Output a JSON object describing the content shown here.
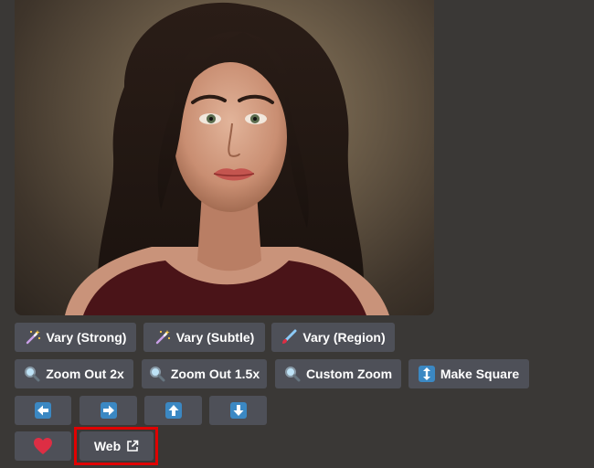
{
  "image": {
    "subject": "portrait-image"
  },
  "row1": [
    {
      "label": "Vary (Strong)",
      "icon": "magic-wand-icon"
    },
    {
      "label": "Vary (Subtle)",
      "icon": "magic-wand-icon"
    },
    {
      "label": "Vary (Region)",
      "icon": "paintbrush-icon"
    }
  ],
  "row2": [
    {
      "label": "Zoom Out 2x",
      "icon": "magnifier-icon"
    },
    {
      "label": "Zoom Out 1.5x",
      "icon": "magnifier-icon"
    },
    {
      "label": "Custom Zoom",
      "icon": "magnifier-icon"
    },
    {
      "label": "Make Square",
      "icon": "up-down-arrow-icon"
    }
  ],
  "row3": [
    {
      "icon": "arrow-left-icon"
    },
    {
      "icon": "arrow-right-icon"
    },
    {
      "icon": "arrow-up-icon"
    },
    {
      "icon": "arrow-down-icon"
    }
  ],
  "row4": {
    "heart_icon": "red-heart-icon",
    "web_label": "Web",
    "web_icon": "external-link-icon"
  },
  "colors": {
    "background": "#3a3836",
    "button": "#4e5058",
    "highlight": "#e00000",
    "arrow_blue": "#3b88c3",
    "heart": "#dd2e44"
  }
}
